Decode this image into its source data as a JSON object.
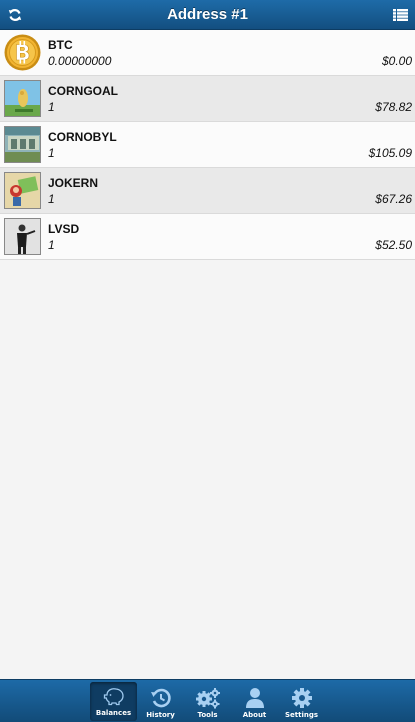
{
  "header": {
    "title": "Address #1"
  },
  "assets": [
    {
      "name": "BTC",
      "quantity": "0.00000000",
      "value": "$0.00",
      "icon": "bitcoin-coin-icon"
    },
    {
      "name": "CORNGOAL",
      "quantity": "1",
      "value": "$78.82",
      "icon": "corngoal-card-image"
    },
    {
      "name": "CORNOBYL",
      "quantity": "1",
      "value": "$105.09",
      "icon": "cornobyl-card-image"
    },
    {
      "name": "JOKERN",
      "quantity": "1",
      "value": "$67.26",
      "icon": "jokern-card-image"
    },
    {
      "name": "LVSD",
      "quantity": "1",
      "value": "$52.50",
      "icon": "lvsd-card-image"
    }
  ],
  "tabs": [
    {
      "label": "Balances",
      "icon": "piggy-bank-icon",
      "active": true
    },
    {
      "label": "History",
      "icon": "history-icon",
      "active": false
    },
    {
      "label": "Tools",
      "icon": "gears-icon",
      "active": false
    },
    {
      "label": "About",
      "icon": "person-icon",
      "active": false
    },
    {
      "label": "Settings",
      "icon": "gear-icon",
      "active": false
    }
  ],
  "colors": {
    "header": "#1a5f98",
    "footer": "#17588e",
    "row_alt": "#e9e9e9",
    "row": "#fbfbfb"
  }
}
